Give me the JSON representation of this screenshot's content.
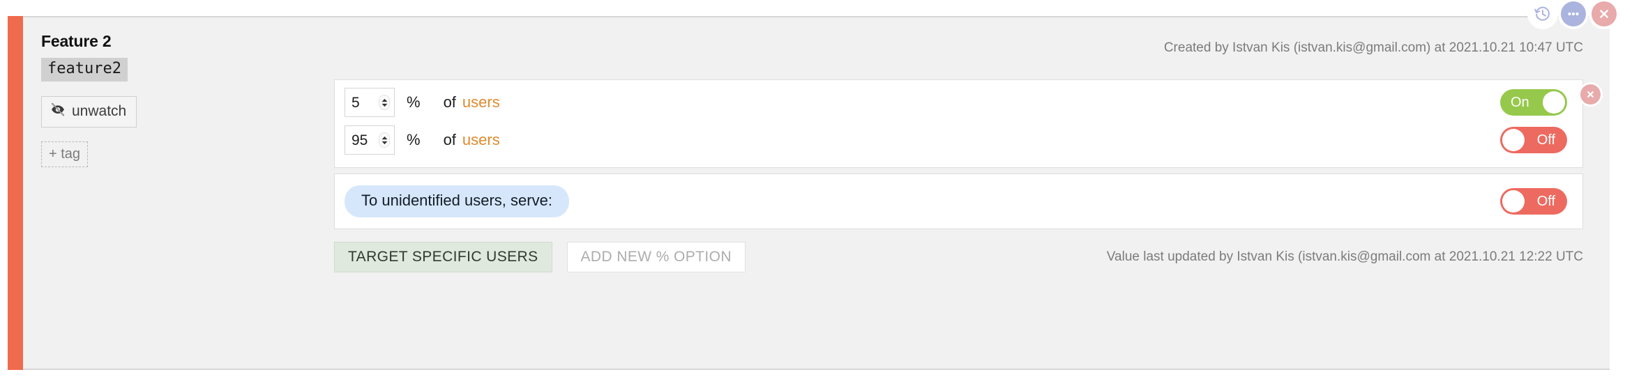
{
  "top_actions": [
    {
      "name": "history-icon",
      "label": "History"
    },
    {
      "name": "more-icon",
      "label": "More options"
    },
    {
      "name": "close-icon",
      "label": "Close"
    }
  ],
  "feature": {
    "title": "Feature 2",
    "key": "feature2",
    "watch_label": "unwatch",
    "watch_icon": "eye-slash-icon",
    "tag_label": "+ tag",
    "created_by": "Created by Istvan Kis (istvan.kis@gmail.com) at 2021.10.21 10:47 UTC",
    "status_color": "#ef6b4e"
  },
  "rules": [
    {
      "percent": "5",
      "percent_sign": "%",
      "of_label": "of",
      "target": "users",
      "toggle": {
        "state": "on",
        "label": "On",
        "color": "#96c84b"
      }
    },
    {
      "percent": "95",
      "percent_sign": "%",
      "of_label": "of",
      "target": "users",
      "toggle": {
        "state": "off",
        "label": "Off",
        "color": "#ed6a60"
      }
    }
  ],
  "fallback": {
    "chip_label": "To unidentified users, serve:",
    "chip_color": "#d7e7fb",
    "toggle": {
      "state": "off",
      "label": "Off",
      "color": "#ed6a60"
    }
  },
  "footer": {
    "target_users_label": "TARGET SPECIFIC USERS",
    "add_option_label": "ADD NEW % OPTION",
    "last_updated": "Value last updated by Istvan Kis (istvan.kis@gmail.com at 2021.10.21 12:22 UTC"
  }
}
